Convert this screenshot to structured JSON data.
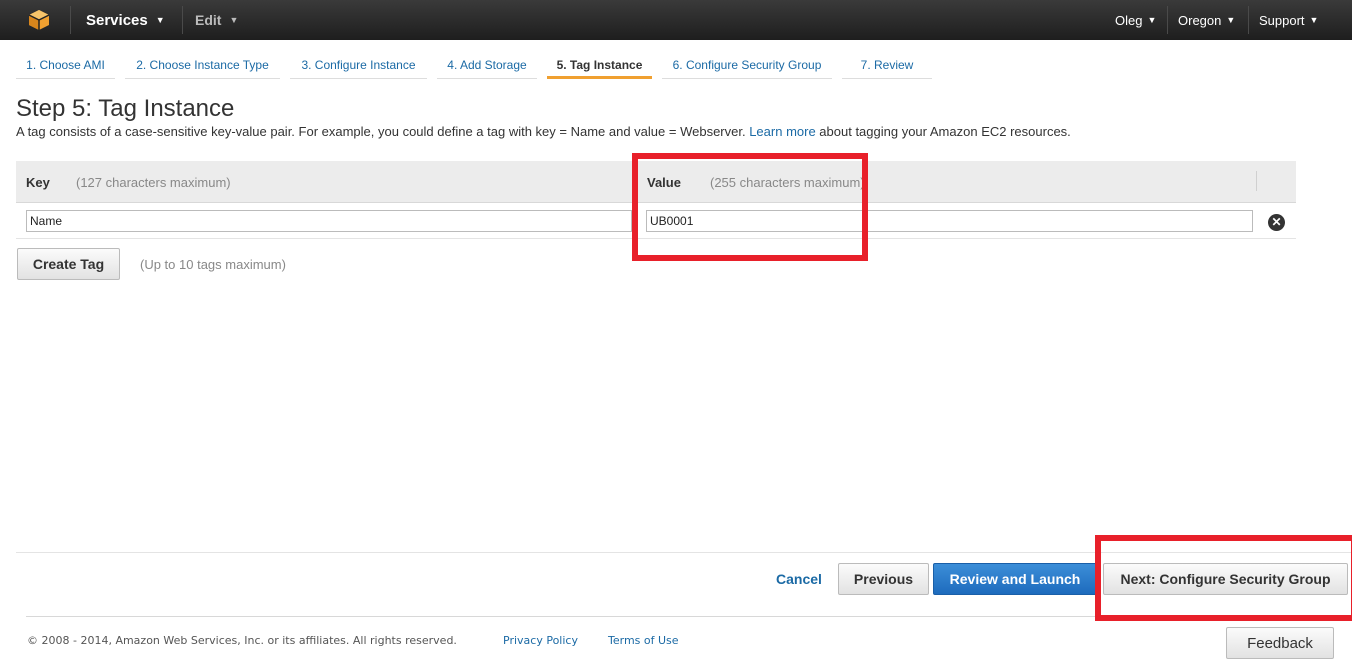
{
  "colors": {
    "nav_bg": "#232323",
    "link": "#1b6aa5",
    "accent_tab": "#f0a030",
    "primary_button": "#1e6bbd",
    "highlight": "#e8202a",
    "logo": "#f0a030"
  },
  "topnav": {
    "logo_icon": "aws-cube-icon",
    "services": "Services",
    "edit": "Edit",
    "user": "Oleg",
    "region": "Oregon",
    "support": "Support"
  },
  "wizard": {
    "tabs": [
      {
        "label": "1. Choose AMI"
      },
      {
        "label": "2. Choose Instance Type"
      },
      {
        "label": "3. Configure Instance"
      },
      {
        "label": "4. Add Storage"
      },
      {
        "label": "5. Tag Instance"
      },
      {
        "label": "6. Configure Security Group"
      },
      {
        "label": "7. Review"
      }
    ],
    "active_index": 4
  },
  "page": {
    "title": "Step 5: Tag Instance",
    "desc_before": "A tag consists of a case-sensitive key-value pair. For example, you could define a tag with key = Name and value = Webserver. ",
    "desc_link": "Learn more",
    "desc_after": " about tagging your Amazon EC2 resources."
  },
  "table": {
    "key_header": "Key",
    "key_hint": "(127 characters maximum)",
    "value_header": "Value",
    "value_hint": "(255 characters maximum)",
    "rows": [
      {
        "key": "Name",
        "value": "UB0001"
      }
    ],
    "remove_icon": "close-circle-icon"
  },
  "actions": {
    "create_tag": "Create Tag",
    "create_hint": "(Up to 10 tags maximum)",
    "cancel": "Cancel",
    "previous": "Previous",
    "review_launch": "Review and Launch",
    "next": "Next: Configure Security Group"
  },
  "footer": {
    "copyright": "© 2008 - 2014, Amazon Web Services, Inc. or its affiliates. All rights reserved.",
    "privacy": "Privacy Policy",
    "terms": "Terms of Use",
    "feedback": "Feedback"
  }
}
